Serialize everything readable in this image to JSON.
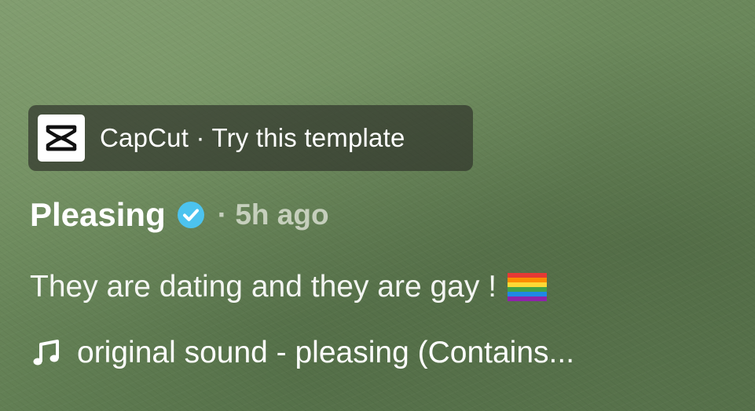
{
  "capcut": {
    "brand": "CapCut",
    "separator": "·",
    "cta": "Try this template",
    "logo_icon": "capcut-logo-icon"
  },
  "author": {
    "name": "Pleasing",
    "verified_icon": "verified-badge-icon",
    "time_ago": "· 5h ago"
  },
  "caption": {
    "text": "They are dating and they are gay !",
    "emoji_icon": "rainbow-flag-icon"
  },
  "sound": {
    "icon": "music-note-icon",
    "text": "original sound - pleasing (Contains..."
  },
  "colors": {
    "background": "#6d8a5d",
    "banner": "#2d302a",
    "verified": "#4cc3ef",
    "text": "#ffffff"
  }
}
